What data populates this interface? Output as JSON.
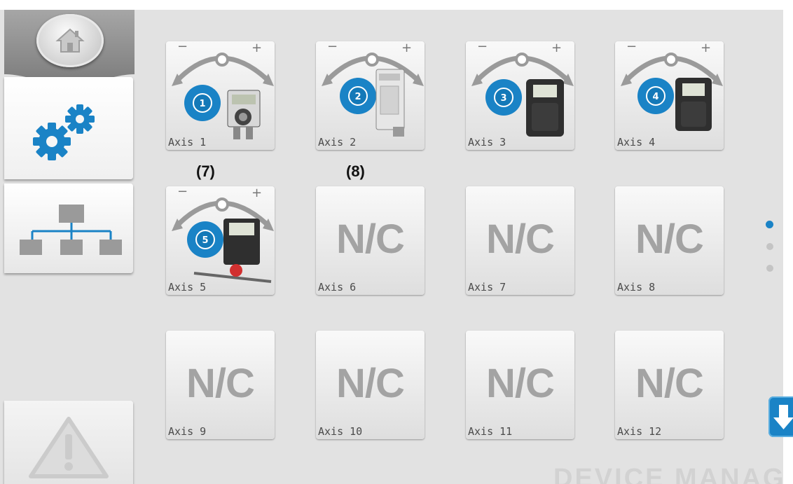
{
  "sidebar": {
    "home": {
      "icon": "home-icon"
    },
    "settings": {
      "icon": "gears-icon",
      "active": true
    },
    "network": {
      "icon": "network-tree-icon"
    },
    "warning": {
      "icon": "warning-icon",
      "enabled": false
    }
  },
  "axes": [
    {
      "label": "Axis 1",
      "number": "1",
      "connected": true,
      "icon": "axis-device-icon"
    },
    {
      "label": "Axis 2",
      "number": "2",
      "connected": true,
      "icon": "axis-device-icon"
    },
    {
      "label": "Axis 3",
      "number": "3",
      "connected": true,
      "icon": "axis-device-icon"
    },
    {
      "label": "Axis 4",
      "number": "4",
      "connected": true,
      "icon": "axis-device-icon"
    },
    {
      "label": "Axis 5",
      "number": "5",
      "connected": true,
      "icon": "axis-device-icon"
    },
    {
      "label": "Axis 6",
      "status": "N/C",
      "connected": false
    },
    {
      "label": "Axis 7",
      "status": "N/C",
      "connected": false
    },
    {
      "label": "Axis 8",
      "status": "N/C",
      "connected": false
    },
    {
      "label": "Axis 9",
      "status": "N/C",
      "connected": false
    },
    {
      "label": "Axis 10",
      "status": "N/C",
      "connected": false
    },
    {
      "label": "Axis 11",
      "status": "N/C",
      "connected": false
    },
    {
      "label": "Axis 12",
      "status": "N/C",
      "connected": false
    }
  ],
  "annotations": {
    "axis1": "(7)",
    "axis2": "(8)"
  },
  "pager": {
    "pages": 3,
    "current": 1
  },
  "scroll_button": {
    "icon": "arrow-down-icon"
  },
  "footer_title": "DEVICE MANAGER",
  "colors": {
    "accent": "#1a83c6",
    "nc_text": "#a3a3a3",
    "background": "#e2e2e2"
  }
}
